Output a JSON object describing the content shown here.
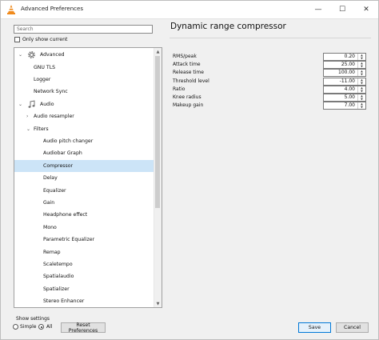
{
  "window": {
    "title": "Advanced Preferences",
    "minimize_glyph": "—",
    "maximize_glyph": "☐",
    "close_glyph": "✕"
  },
  "search": {
    "placeholder": "Search",
    "value": ""
  },
  "only_show_current": {
    "label": "Only show current",
    "checked": false
  },
  "tree": {
    "items": [
      {
        "label": "Advanced",
        "level": 0,
        "expanded": true,
        "icon": "gear-icon"
      },
      {
        "label": "GNU TLS",
        "level": 1
      },
      {
        "label": "Logger",
        "level": 1
      },
      {
        "label": "Network Sync",
        "level": 1
      },
      {
        "label": "Audio",
        "level": 0,
        "expanded": true,
        "icon": "music-note-icon"
      },
      {
        "label": "Audio resampler",
        "level": 1,
        "expanded": false
      },
      {
        "label": "Filters",
        "level": 1,
        "expanded": true
      },
      {
        "label": "Audio pitch changer",
        "level": 2
      },
      {
        "label": "Audiobar Graph",
        "level": 2
      },
      {
        "label": "Compressor",
        "level": 2,
        "selected": true
      },
      {
        "label": "Delay",
        "level": 2
      },
      {
        "label": "Equalizer",
        "level": 2
      },
      {
        "label": "Gain",
        "level": 2
      },
      {
        "label": "Headphone effect",
        "level": 2
      },
      {
        "label": "Mono",
        "level": 2
      },
      {
        "label": "Parametric Equalizer",
        "level": 2
      },
      {
        "label": "Remap",
        "level": 2
      },
      {
        "label": "Scaletempo",
        "level": 2
      },
      {
        "label": "Spatialaudio",
        "level": 2
      },
      {
        "label": "Spatializer",
        "level": 2
      },
      {
        "label": "Stereo Enhancer",
        "level": 2
      }
    ]
  },
  "panel": {
    "title": "Dynamic range compressor",
    "fields": [
      {
        "label": "RMS/peak",
        "value": "0.20"
      },
      {
        "label": "Attack time",
        "value": "25.00"
      },
      {
        "label": "Release time",
        "value": "100.00"
      },
      {
        "label": "Threshold level",
        "value": "-11.00"
      },
      {
        "label": "Ratio",
        "value": "4.00"
      },
      {
        "label": "Knee radius",
        "value": "5.00"
      },
      {
        "label": "Makeup gain",
        "value": "7.00"
      }
    ]
  },
  "show_settings": {
    "label": "Show settings",
    "options": [
      {
        "label": "Simple",
        "checked": false
      },
      {
        "label": "All",
        "checked": true
      }
    ]
  },
  "buttons": {
    "reset": "Reset Preferences",
    "save": "Save",
    "cancel": "Cancel"
  },
  "colors": {
    "selection": "#cce4f7",
    "accent": "#0078d7",
    "vlc_orange": "#f08a1c"
  }
}
